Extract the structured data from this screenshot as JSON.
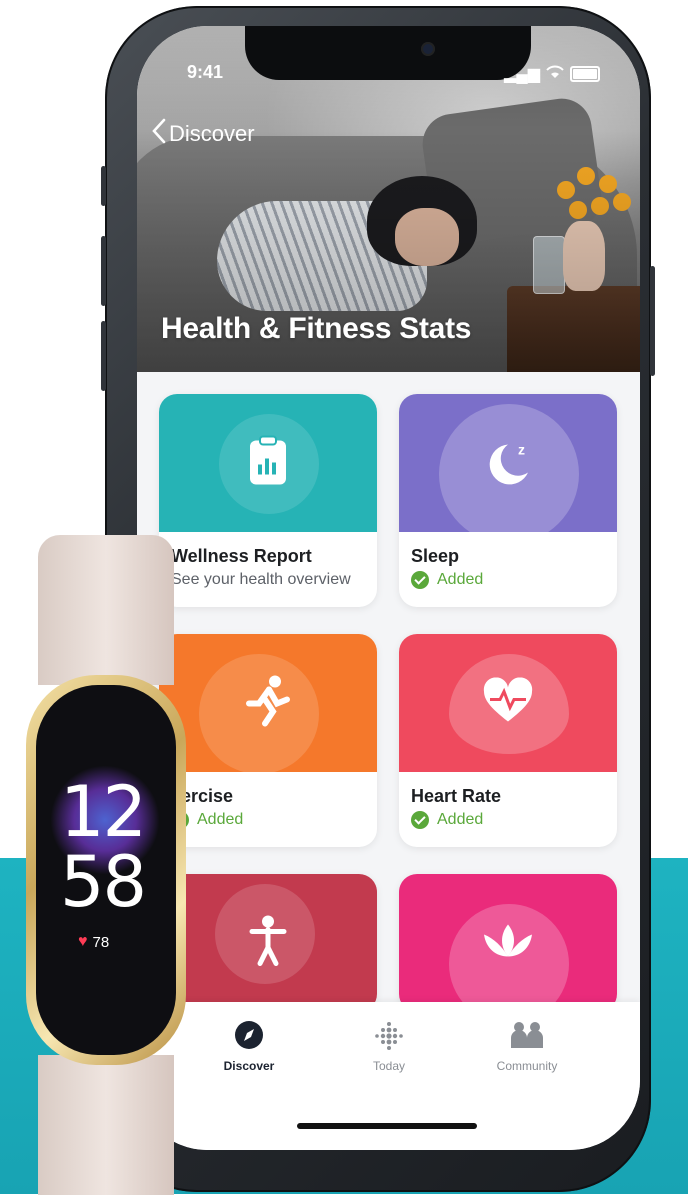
{
  "status_bar": {
    "time": "9:41"
  },
  "header": {
    "back_label": "Discover",
    "title": "Health & Fitness Stats"
  },
  "cards": [
    {
      "title": "Wellness Report",
      "subtitle": "See your health overview",
      "added": false,
      "color": "#26b3b5",
      "icon": "clipboard-chart-icon"
    },
    {
      "title": "Sleep",
      "subtitle": "Added",
      "added": true,
      "color": "#7b6fc9",
      "icon": "moon-zz-icon"
    },
    {
      "title": "xercise",
      "subtitle": "Added",
      "added": true,
      "color": "#f5782b",
      "icon": "running-person-icon"
    },
    {
      "title": "Heart Rate",
      "subtitle": "Added",
      "added": true,
      "color": "#ef4a5e",
      "icon": "heart-pulse-icon"
    },
    {
      "title": "",
      "subtitle": "",
      "added": false,
      "color": "#c23a4e",
      "icon": "stretching-person-icon"
    },
    {
      "title": "",
      "subtitle": "",
      "added": false,
      "color": "#ea2b7b",
      "icon": "lotus-icon"
    }
  ],
  "nav": {
    "items": [
      {
        "label": "Discover",
        "active": true
      },
      {
        "label": "Today",
        "active": false
      },
      {
        "label": "Community",
        "active": false
      }
    ]
  },
  "device": {
    "hour": "12",
    "minute": "58",
    "heart_rate": "78"
  },
  "colors": {
    "accent_teal": "#1eb3c1",
    "added_green": "#5aa83a"
  }
}
